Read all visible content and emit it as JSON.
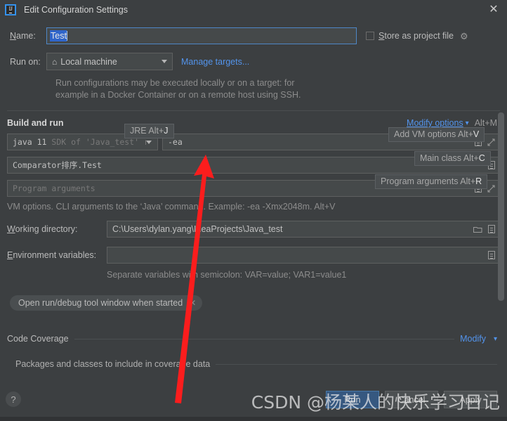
{
  "window": {
    "title": "Edit Configuration Settings",
    "logo_text": "IJ",
    "close_label": "✕"
  },
  "name_row": {
    "label": "Name:",
    "value": "Test",
    "store_as_project_file": "Store as project file",
    "gear_icon": "⚙"
  },
  "run_on": {
    "label": "Run on:",
    "selected": "Local machine",
    "home_icon": "⌂",
    "manage_targets": "Manage targets...",
    "description_line1": "Run configurations may be executed locally or on a target: for",
    "description_line2": "example in a Docker Container or on a remote host using SSH."
  },
  "build_and_run": {
    "section_title": "Build and run",
    "modify_options": "Modify options",
    "modify_options_shortcut": "Alt+M",
    "jre_value": "java 11",
    "jre_suffix": "SDK of 'Java_test' r",
    "vm_options_value": "-ea",
    "main_class_value": "Comparator排序.Test",
    "program_arguments_placeholder": "Program arguments",
    "vm_hint": "VM options. CLI arguments to the ‘Java’ command. Example: -ea -Xmx2048m. Alt+V"
  },
  "keyboard_hints": [
    {
      "text": "JRE Alt+",
      "key": "J"
    },
    {
      "text": "Add VM options Alt+",
      "key": "V"
    },
    {
      "text": "Main class Alt+",
      "key": "C"
    },
    {
      "text": "Program arguments Alt+",
      "key": "R"
    }
  ],
  "working_directory": {
    "label": "Working directory:",
    "value": "C:\\Users\\dylan.yang\\IdeaProjects\\Java_test"
  },
  "environment_variables": {
    "label": "Environment variables:",
    "value": "",
    "note": "Separate variables with semicolon: VAR=value; VAR1=value1"
  },
  "chip": {
    "label": "Open run/debug tool window when started",
    "close_icon": "✕"
  },
  "code_coverage": {
    "title": "Code Coverage",
    "modify": "Modify",
    "sub_title": "Packages and classes to include in coverage data"
  },
  "bottom": {
    "help": "?",
    "run": "Run",
    "cancel": "Cancel",
    "apply": "Apply"
  },
  "watermark": "CSDN @杨某人的快乐学习日记",
  "colors": {
    "accent_link": "#5394ec",
    "selection": "#2f65ca",
    "primary_button": "#365880",
    "annotation_arrow": "#fb1d1d",
    "background": "#3c3f41",
    "field_background": "#45494a"
  }
}
